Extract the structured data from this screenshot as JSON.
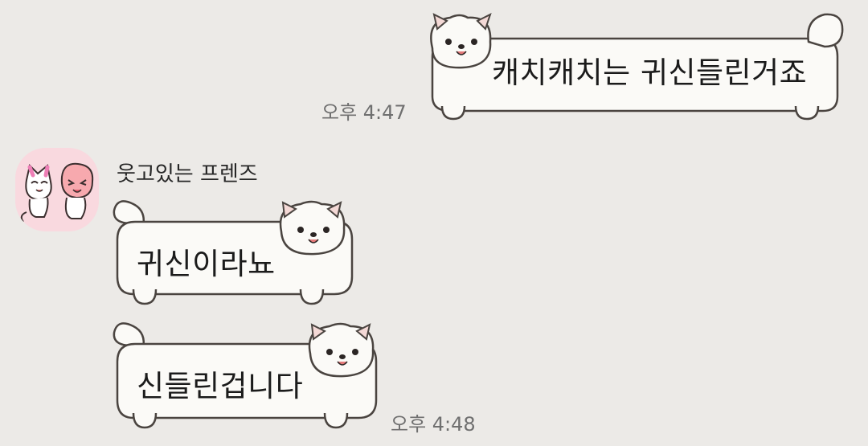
{
  "colors": {
    "background": "#ECEAE7",
    "bubble_fill": "#FBFAF7",
    "bubble_outline": "#4A4440",
    "time_text": "#6F6F6F",
    "avatar_bg": "#F9D9DF"
  },
  "messages": [
    {
      "direction": "outgoing",
      "text": "캐치캐치는 귀신들린거죠",
      "time": "오후 4:47",
      "sticker": "pomeranian-dog-bubble"
    },
    {
      "direction": "incoming",
      "sender": "웃고있는 프렌즈",
      "avatar": "cat-and-peach-avatar",
      "text": "귀신이라뇨",
      "sticker": "pomeranian-dog-bubble"
    },
    {
      "direction": "incoming",
      "text": "신들린겁니다",
      "time": "오후 4:48",
      "sticker": "pomeranian-dog-bubble"
    }
  ]
}
